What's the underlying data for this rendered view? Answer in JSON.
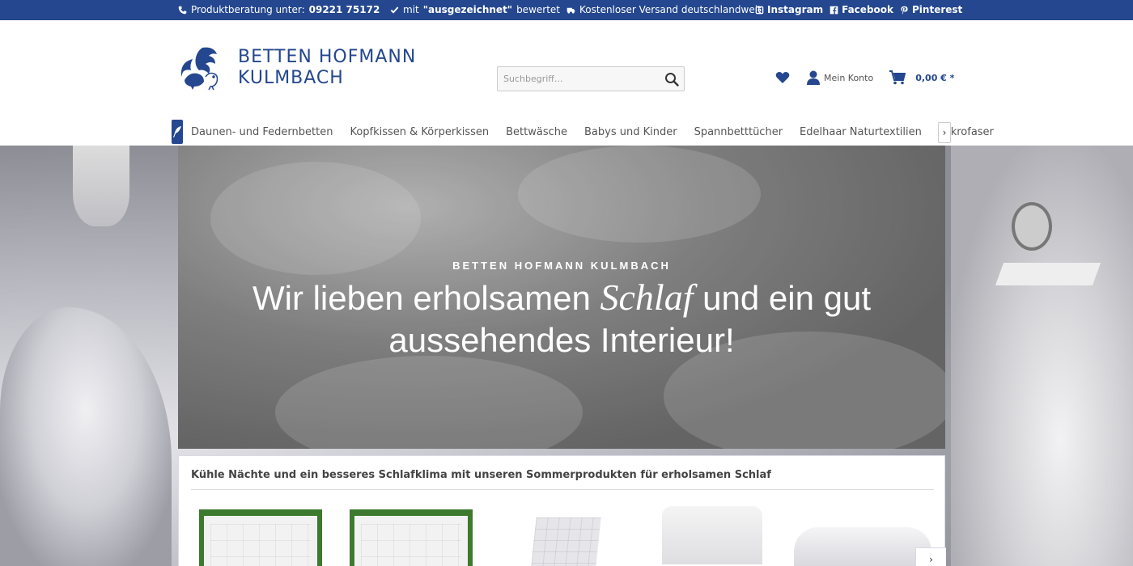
{
  "topbar": {
    "hotline_prefix": "Produktberatung unter:",
    "hotline_number": "09221 75172",
    "rating_prefix": "mit",
    "rating_strong": "\"ausgezeichnet\"",
    "rating_suffix": "bewertet",
    "shipping": "Kostenloser Versand deutschlandweit",
    "social": {
      "instagram": "Instagram",
      "facebook": "Facebook",
      "pinterest": "Pinterest"
    }
  },
  "header": {
    "logo_line1": "BETTEN HOFMANN",
    "logo_line2": "KULMBACH",
    "search_placeholder": "Suchbegriff...",
    "account_label": "Mein Konto",
    "cart_total": "0,00 € *"
  },
  "nav": {
    "items": [
      {
        "label": "Daunen- und Federnbetten"
      },
      {
        "label": "Kopfkissen & Körperkissen"
      },
      {
        "label": "Bettwäsche"
      },
      {
        "label": "Babys und Kinder"
      },
      {
        "label": "Spannbetttücher"
      },
      {
        "label": "Edelhaar Naturtextilien"
      },
      {
        "label": "Mikrofaser"
      }
    ]
  },
  "hero": {
    "eyebrow": "BETTEN HOFMANN KULMBACH",
    "headline_part1": "Wir lieben erholsamen",
    "headline_em": "Schlaf",
    "headline_part2": "und ein gut",
    "headline_line2": "aussehendes Interieur!"
  },
  "products": {
    "title": "Kühle Nächte und ein besseres Schlafklima mit unseren Sommerprodukten für erholsamen Schlaf"
  },
  "colors": {
    "brand_blue": "#24478f",
    "border": "#dadae5"
  }
}
